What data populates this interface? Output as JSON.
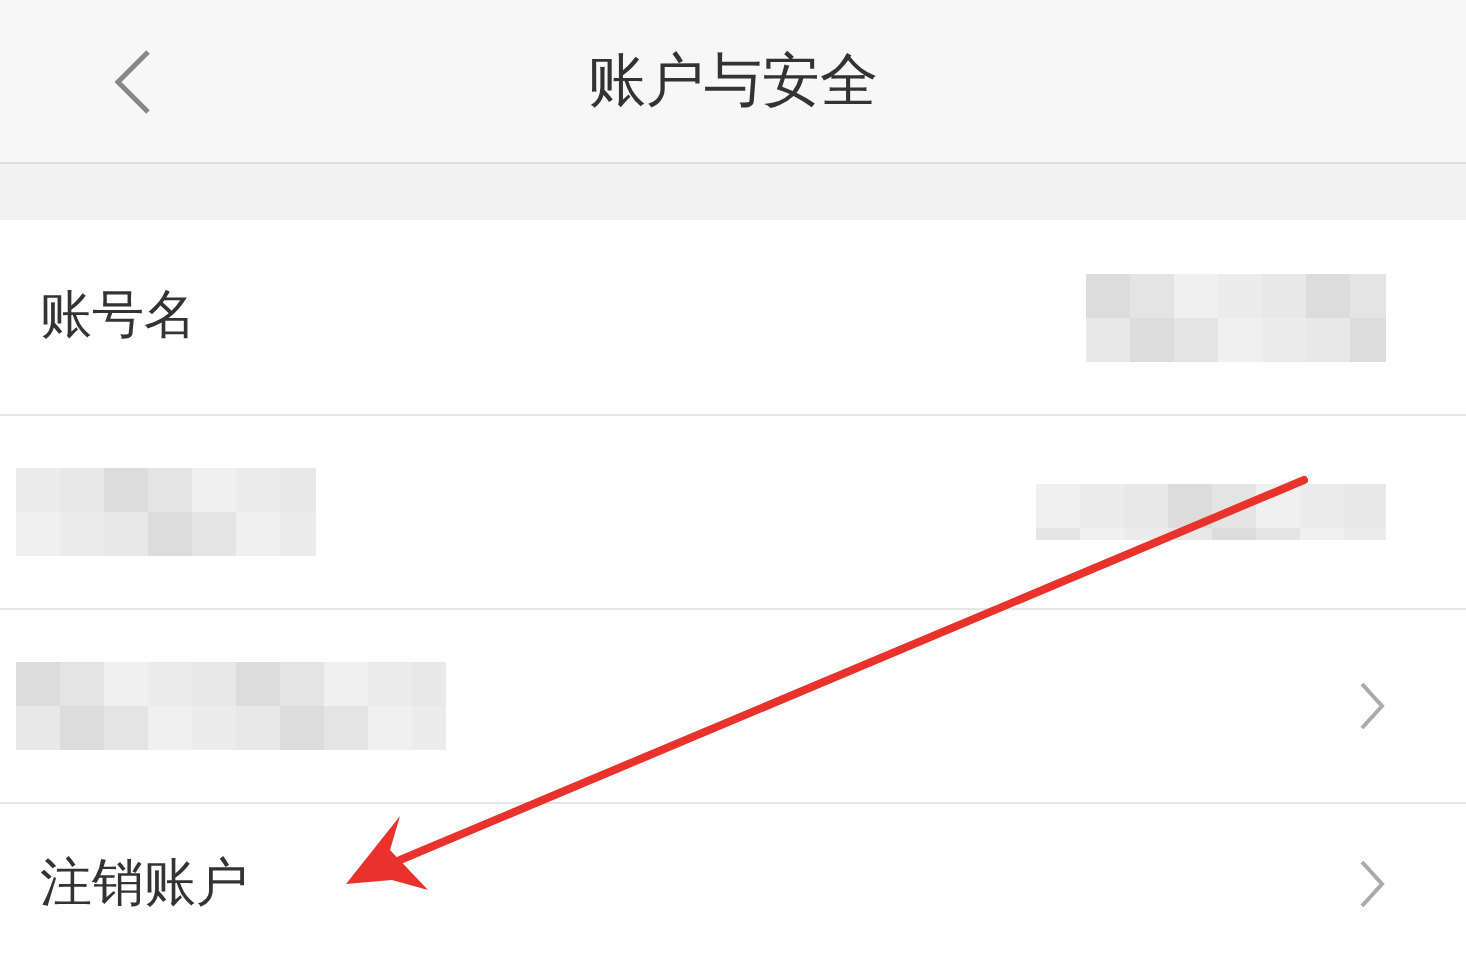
{
  "header": {
    "back_icon": true,
    "title": "账户与安全"
  },
  "rows": [
    {
      "label": "账号名",
      "label_hidden": false,
      "value_hidden": true,
      "chevron": false
    },
    {
      "label_hidden": true,
      "value_hidden": true,
      "chevron": false
    },
    {
      "label_hidden": true,
      "value_hidden": false,
      "chevron": true
    },
    {
      "label": "注销账户",
      "label_hidden": false,
      "value_hidden": false,
      "chevron": true
    }
  ],
  "annotation_arrow": true
}
